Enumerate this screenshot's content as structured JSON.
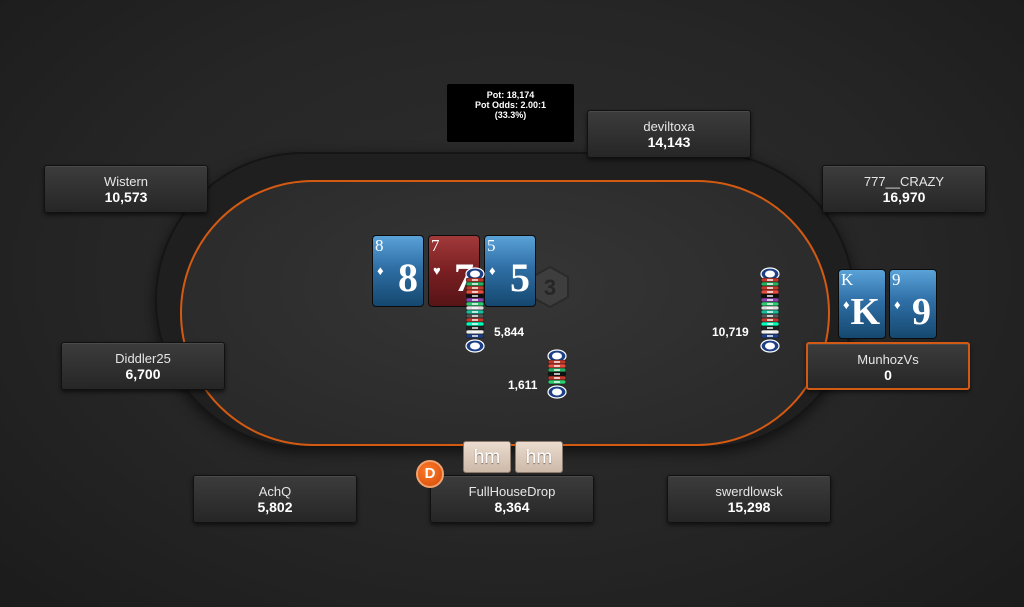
{
  "pot": {
    "line1": "Pot: 18,174",
    "line2": "Pot Odds: 2.00:1",
    "line3": "(33.3%)"
  },
  "logo": {
    "label": "3"
  },
  "players": {
    "deviltoxa": {
      "name": "deviltoxa",
      "stack": "14,143"
    },
    "wistern": {
      "name": "Wistern",
      "stack": "10,573"
    },
    "crazy": {
      "name": "777__CRAZY",
      "stack": "16,970"
    },
    "diddler": {
      "name": "Diddler25",
      "stack": "6,700"
    },
    "munhoz": {
      "name": "MunhozVs",
      "stack": "0"
    },
    "achq": {
      "name": "AchQ",
      "stack": "5,802"
    },
    "fullhouse": {
      "name": "FullHouseDrop",
      "stack": "8,364"
    },
    "swerd": {
      "name": "swerdlowsk",
      "stack": "15,298"
    }
  },
  "board": [
    {
      "rank": "8",
      "suit": "♦",
      "color": "blue"
    },
    {
      "rank": "7",
      "suit": "♥",
      "color": "red"
    },
    {
      "rank": "5",
      "suit": "♦",
      "color": "blue"
    }
  ],
  "hole_cards": [
    {
      "rank": "K",
      "suit": "♦",
      "color": "blue"
    },
    {
      "rank": "9",
      "suit": "♦",
      "color": "blue"
    }
  ],
  "bets": {
    "center": "5,844",
    "small": "1,611",
    "right": "10,719"
  },
  "dealer_button": "D",
  "hud": {
    "btn1": "hm",
    "btn2": "hm"
  }
}
